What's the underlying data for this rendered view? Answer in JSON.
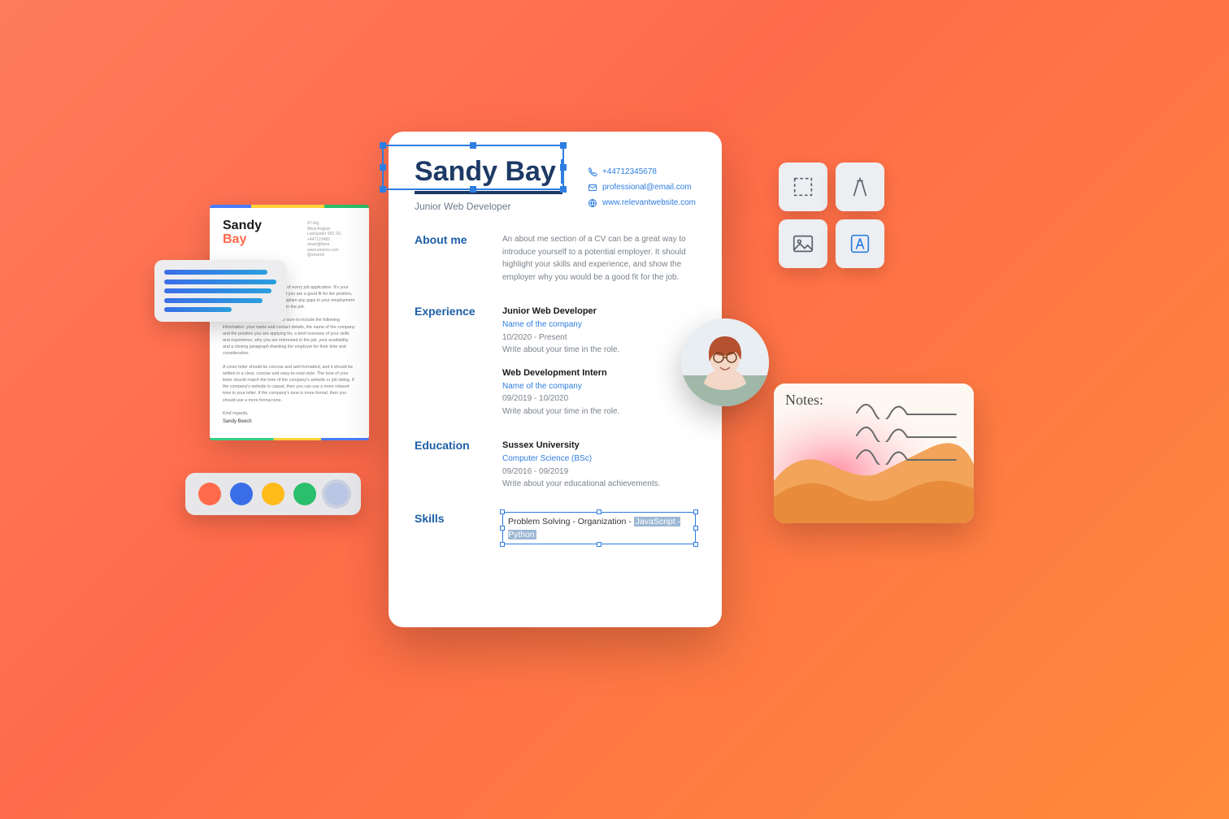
{
  "cover_letter": {
    "first_name": "Sandy",
    "last_name": "Bay",
    "meta_lines": [
      "47 Eig",
      "West Angton",
      "Laelspater S81 2G",
      "+447123456",
      "smart@here",
      "www.smzrev.com",
      "@smzrdv"
    ],
    "paragraphs": [
      "A cover letter is an important part of every job application. It's your chance to show the employer that you are a good fit for the position, and it's also your opportunity to explain any gaps in your employment history or why you are interested in the job.",
      "When you write a cover letter, be sure to include the following information: your name and contact details, the name of the company and the position you are applying for, a brief overview of your skills and experience, why you are interested in the job, your availability and a closing paragraph thanking the employer for their time and consideration.",
      "A cover letter should be concise and well formatted, and it should be written in a clear, concise and easy-to-read style. The tone of your letter should match the tone of the company's website or job listing. If the company's website is casual, then you can use a more relaxed tone in your letter. If the company's tone is more formal, then you should use a more formal tone.",
      "Kind regards,"
    ],
    "signature": "Sandy Beech"
  },
  "swatches": [
    {
      "color": "#ff6b4a",
      "selected": false
    },
    {
      "color": "#3a6ee8",
      "selected": false
    },
    {
      "color": "#ffbb1a",
      "selected": false
    },
    {
      "color": "#2abf6c",
      "selected": false
    },
    {
      "color": "#b9c6e4",
      "selected": true
    }
  ],
  "resume": {
    "name": "Sandy Bay",
    "subtitle": "Junior Web Developer",
    "contact": {
      "phone": "+44712345678",
      "email": "professional@email.com",
      "web": "www.relevantwebsite.com"
    },
    "about": {
      "label": "About me",
      "text": "An about me section of a CV can be a great way to introduce yourself to a potential employer. It should highlight your skills and experience, and show the employer why you would be a good fit for the job."
    },
    "experience": {
      "label": "Experience",
      "items": [
        {
          "title": "Junior Web Developer",
          "company": "Name of the company",
          "dates": "10/2020 - Present",
          "desc": "Write about your time in the role."
        },
        {
          "title": "Web Development Intern",
          "company": "Name of the company",
          "dates": "09/2019 - 10/2020",
          "desc": "Write about your time in the role."
        }
      ]
    },
    "education": {
      "label": "Education",
      "item": {
        "title": "Sussex University",
        "company": "Computer Science (BSc)",
        "dates": "09/2016 - 09/2019",
        "desc": "Write about your educational achievements."
      }
    },
    "skills": {
      "label": "Skills",
      "plain": "Problem Solving - Organization - ",
      "highlighted": "JavaScript - Python"
    }
  },
  "tools": [
    {
      "name": "selection-tool",
      "active": false
    },
    {
      "name": "precision-tool",
      "active": false
    },
    {
      "name": "image-tool",
      "active": false
    },
    {
      "name": "text-tool",
      "active": true
    }
  ],
  "note": {
    "title": "Notes:"
  }
}
